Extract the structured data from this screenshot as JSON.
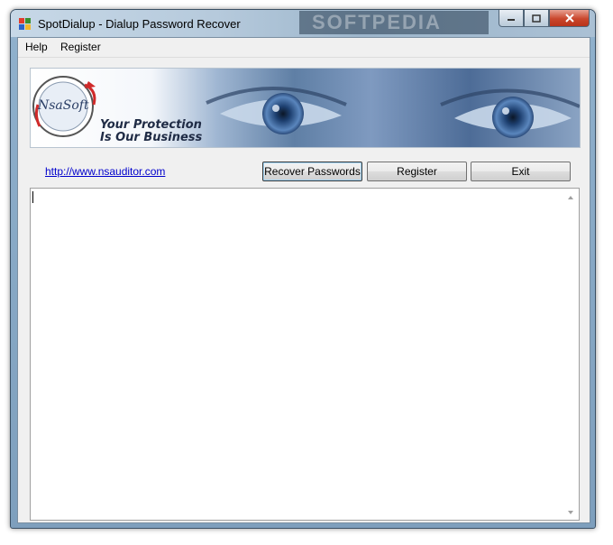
{
  "window": {
    "title": "SpotDialup - Dialup Password Recover",
    "watermark": "SOFTPEDIA",
    "controls": {
      "minimize": "minimize",
      "maximize": "maximize",
      "close": "close"
    }
  },
  "menu": {
    "items": [
      "Help",
      "Register"
    ]
  },
  "banner": {
    "logo_text": "NsaSoft",
    "slogan_line1": "Your Protection",
    "slogan_line2": "Is Our Business"
  },
  "toolbar": {
    "link": "http://www.nsauditor.com",
    "recover_label": "Recover Passwords",
    "register_label": "Register",
    "exit_label": "Exit"
  },
  "output": {
    "text": ""
  },
  "colors": {
    "link": "#0000cc",
    "close_button": "#c9462c",
    "frame": "#8fb0cc"
  }
}
